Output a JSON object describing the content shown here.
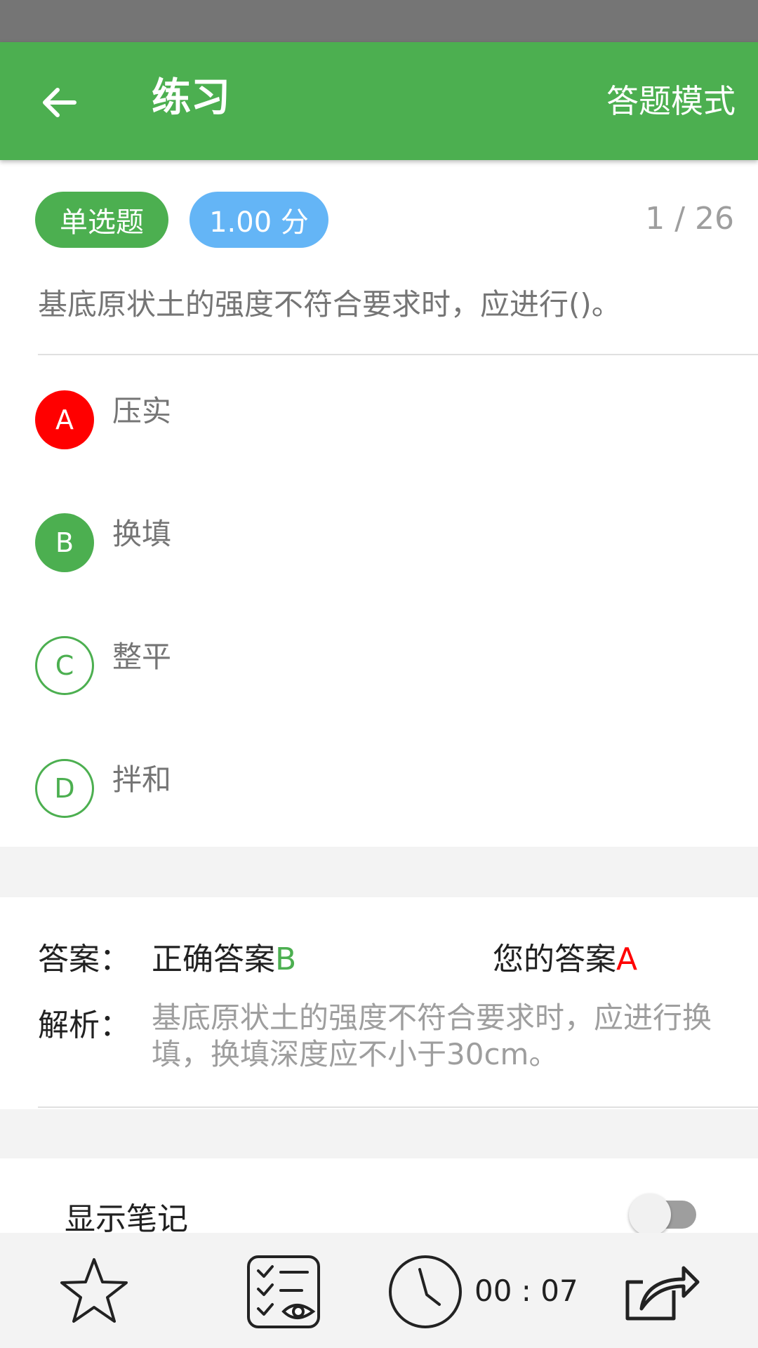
{
  "app_bar": {
    "title": "练习",
    "mode": "答题模式",
    "back_icon": "arrow-left-icon",
    "color": "#4caf50"
  },
  "question": {
    "type_tag": "单选题",
    "score_tag": "1.00 分",
    "progress": "1 / 26",
    "text": "基底原状土的强度不符合要求时，应进行()。",
    "options": [
      {
        "letter": "A",
        "text": "压实",
        "state": "wrong"
      },
      {
        "letter": "B",
        "text": "换填",
        "state": "correct"
      },
      {
        "letter": "C",
        "text": "整平",
        "state": "normal"
      },
      {
        "letter": "D",
        "text": "拌和",
        "state": "normal"
      }
    ]
  },
  "answer": {
    "label": "答案：",
    "correct_prefix": "正确答案",
    "correct_letter": "B",
    "yours_prefix": "您的答案",
    "yours_letter": "A",
    "analysis_label": "解析：",
    "analysis_text": "基底原状土的强度不符合要求时，应进行换填，换填深度应不小于30cm。"
  },
  "notes": {
    "label": "显示笔记",
    "enabled": false
  },
  "bottom_bar": {
    "timer": "00 : 07",
    "icons": [
      "star-icon",
      "answer-sheet-icon",
      "clock-icon",
      "share-icon"
    ]
  },
  "colors": {
    "green": "#4caf50",
    "blue": "#64b5f6",
    "red": "#ff0000"
  }
}
